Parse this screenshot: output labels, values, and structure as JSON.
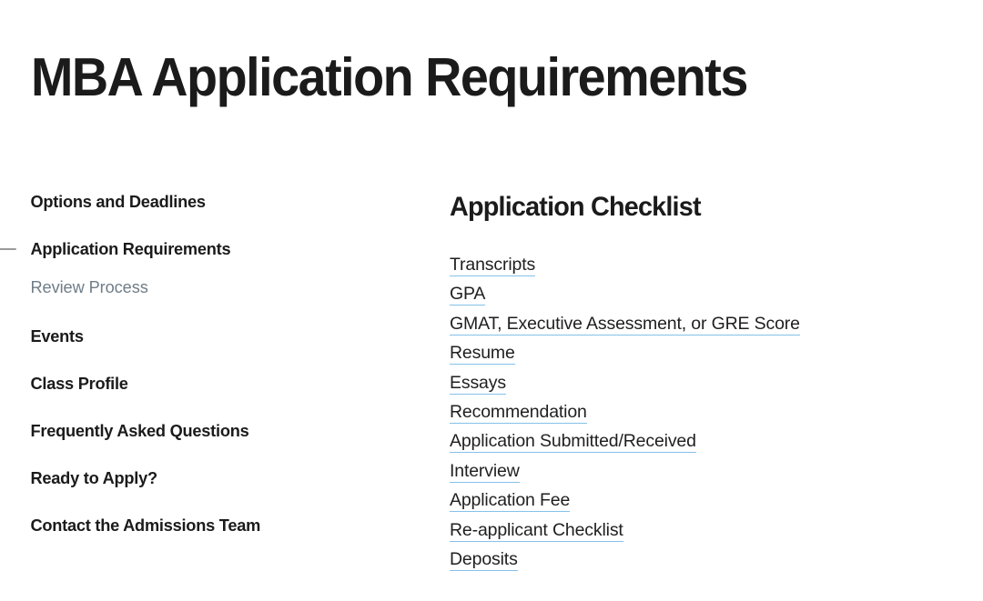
{
  "page": {
    "title": "MBA Application Requirements",
    "background_color": "#ffffff",
    "text_color": "#1b1b1b"
  },
  "sidebar": {
    "active_marker": "dash",
    "muted_color": "#707d88",
    "items": [
      {
        "label": "Options and Deadlines",
        "state": "default",
        "level": "top"
      },
      {
        "label": "Application Requirements",
        "state": "active",
        "level": "top"
      },
      {
        "label": "Review Process",
        "state": "muted",
        "level": "sub"
      },
      {
        "label": "Events",
        "state": "default",
        "level": "top"
      },
      {
        "label": "Class Profile",
        "state": "default",
        "level": "top"
      },
      {
        "label": "Frequently Asked Questions",
        "state": "default",
        "level": "top"
      },
      {
        "label": "Ready to Apply?",
        "state": "default",
        "level": "top"
      },
      {
        "label": "Contact the Admissions Team",
        "state": "default",
        "level": "top"
      }
    ]
  },
  "main": {
    "heading": "Application Checklist",
    "link_underline_color": "#86c1ea",
    "checklist": [
      {
        "label": "Transcripts"
      },
      {
        "label": "GPA"
      },
      {
        "label": "GMAT, Executive Assessment, or GRE Score"
      },
      {
        "label": "Resume"
      },
      {
        "label": "Essays"
      },
      {
        "label": "Recommendation"
      },
      {
        "label": "Application Submitted/Received"
      },
      {
        "label": "Interview"
      },
      {
        "label": "Application Fee"
      },
      {
        "label": "Re-applicant Checklist"
      },
      {
        "label": "Deposits"
      }
    ]
  }
}
